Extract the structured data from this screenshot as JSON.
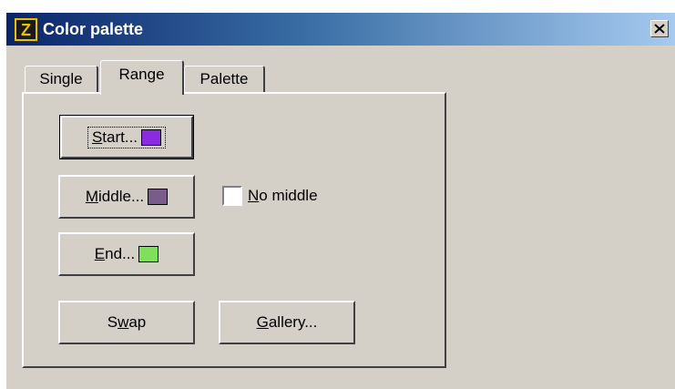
{
  "window": {
    "title": "Color palette",
    "app_icon_letter": "Z",
    "close_label": "×"
  },
  "tabs": [
    {
      "label": "Single",
      "active": false
    },
    {
      "label": "Range",
      "active": true
    },
    {
      "label": "Palette",
      "active": false
    }
  ],
  "range_panel": {
    "start_button": {
      "mnemonic": "S",
      "rest": "tart...",
      "swatch_color": "#8a2be2"
    },
    "middle_button": {
      "mnemonic": "M",
      "rest": "iddle...",
      "swatch_color": "#7a5c8a"
    },
    "end_button": {
      "mnemonic": "E",
      "rest": "nd...",
      "swatch_color": "#7fe05a"
    },
    "no_middle": {
      "mnemonic": "N",
      "rest": "o middle",
      "checked": false
    },
    "swap_button": {
      "before": "S",
      "mnemonic": "w",
      "rest": "ap"
    },
    "gallery_button": {
      "mnemonic": "G",
      "rest": "allery..."
    }
  }
}
